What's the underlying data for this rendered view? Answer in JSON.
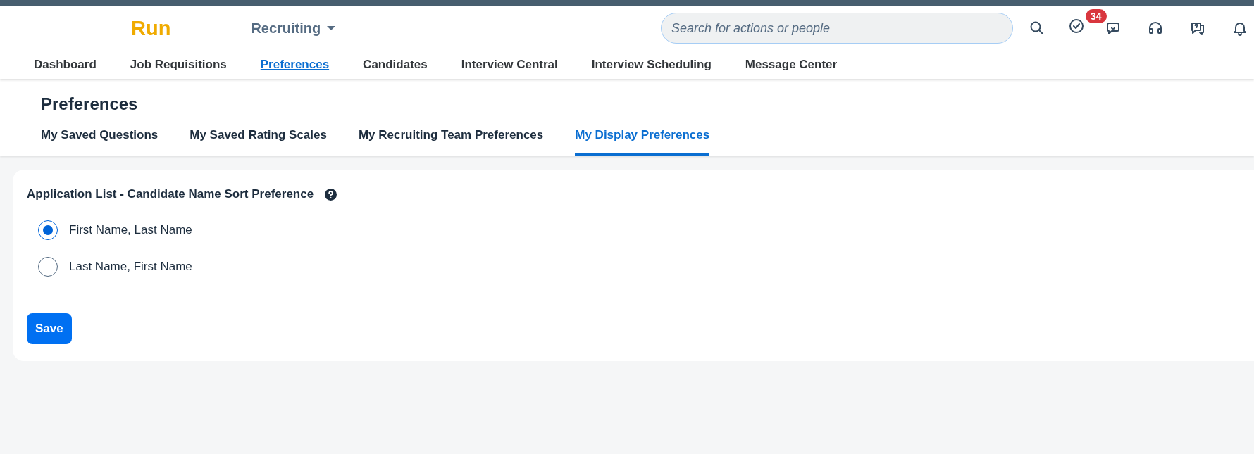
{
  "header": {
    "logo": "Run",
    "module": "Recruiting",
    "search": {
      "placeholder": "Search for actions or people"
    },
    "todo_badge": "34"
  },
  "nav": [
    {
      "label": "Dashboard",
      "selected": false
    },
    {
      "label": "Job Requisitions",
      "selected": false
    },
    {
      "label": "Preferences",
      "selected": true
    },
    {
      "label": "Candidates",
      "selected": false
    },
    {
      "label": "Interview Central",
      "selected": false
    },
    {
      "label": "Interview Scheduling",
      "selected": false
    },
    {
      "label": "Message Center",
      "selected": false
    }
  ],
  "page_title": "Preferences",
  "tabs": [
    {
      "label": "My Saved Questions",
      "selected": false
    },
    {
      "label": "My Saved Rating Scales",
      "selected": false
    },
    {
      "label": "My Recruiting Team Preferences",
      "selected": false
    },
    {
      "label": "My Display Preferences",
      "selected": true
    }
  ],
  "section": {
    "title": "Application List - Candidate Name Sort Preference",
    "options": [
      {
        "label": "First Name, Last Name",
        "selected": true
      },
      {
        "label": "Last Name, First Name",
        "selected": false
      }
    ],
    "save_button": "Save"
  }
}
